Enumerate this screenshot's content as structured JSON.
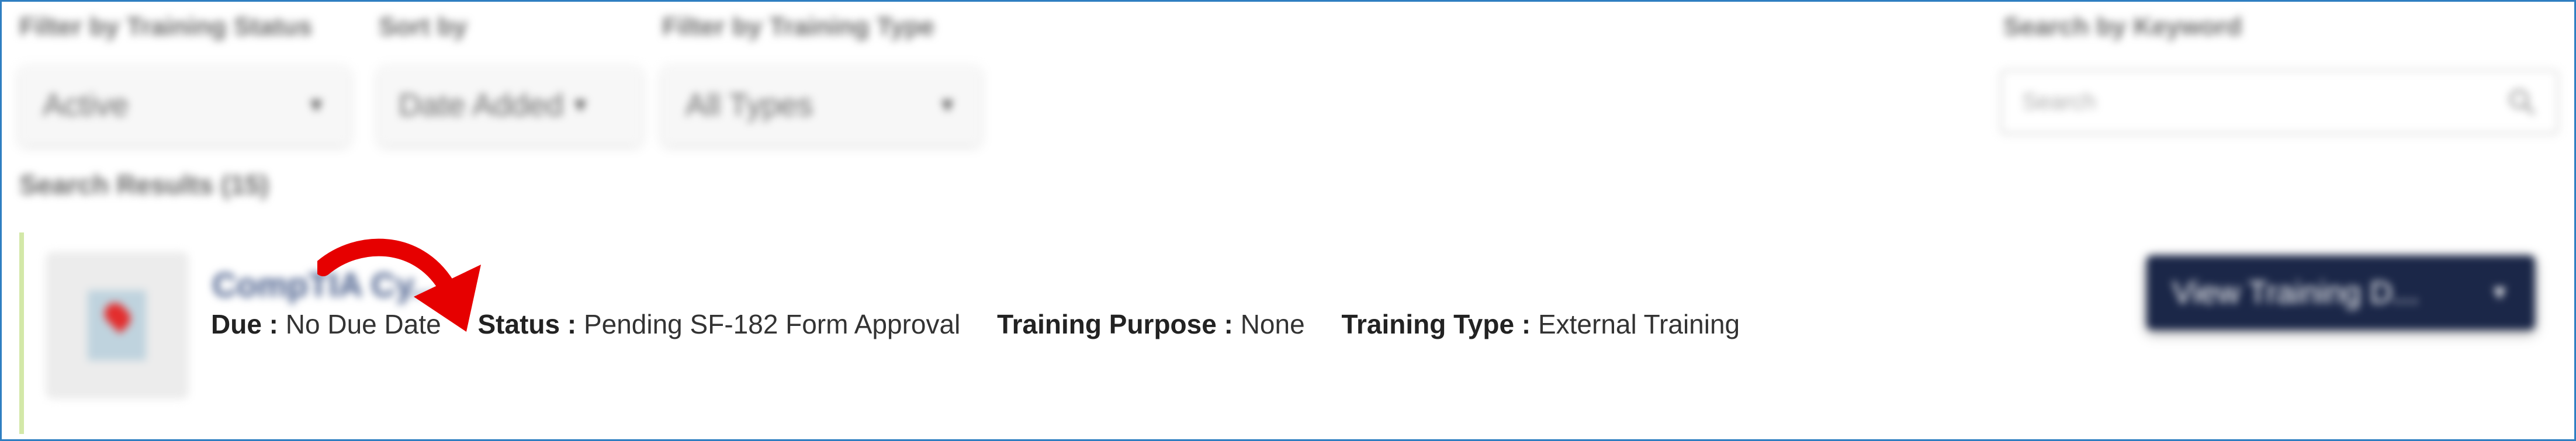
{
  "filters": {
    "status": {
      "label": "Filter by Training Status",
      "value": "Active"
    },
    "sort": {
      "label": "Sort by",
      "value": "Date Added"
    },
    "type": {
      "label": "Filter by Training Type",
      "value": "All Types"
    }
  },
  "search": {
    "label": "Search by Keyword",
    "placeholder": "Search",
    "icon": "search-icon"
  },
  "results": {
    "label": "Search Results (15)",
    "items": [
      {
        "title": "CompTIA Cy...",
        "fields": [
          {
            "key": "Due :",
            "value": "No Due Date"
          },
          {
            "key": "Status :",
            "value": "Pending SF-182 Form Approval"
          },
          {
            "key": "Training Purpose :",
            "value": "None"
          },
          {
            "key": "Training Type :",
            "value": "External Training"
          }
        ],
        "action_label": "View Training D..."
      }
    ]
  },
  "colors": {
    "frame_border": "#2f7fc1",
    "button_bg": "#1b2748",
    "annotation_arrow": "#e60000",
    "row_accent": "#d3e8a8"
  },
  "icons": {
    "dropdown": "caret-down-icon",
    "annotation": "curved-red-arrow-icon"
  }
}
